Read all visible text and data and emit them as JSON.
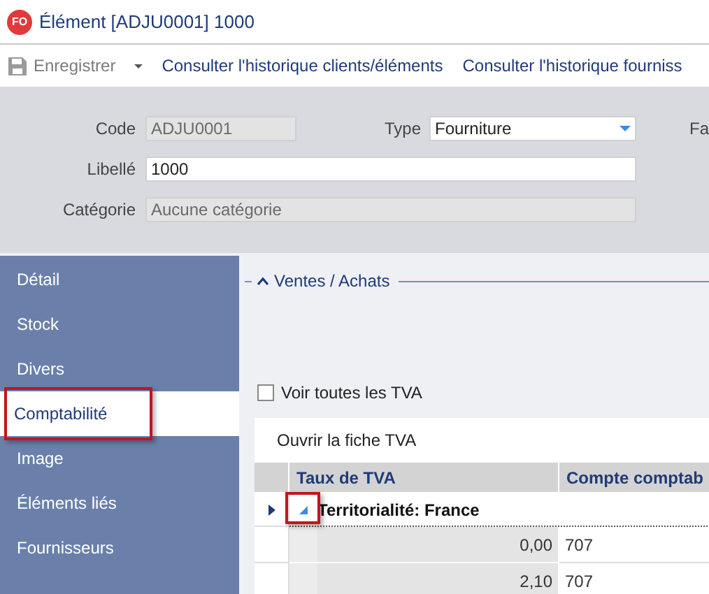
{
  "window": {
    "title": "Élément [ADJU0001] 1000",
    "logo": "FO"
  },
  "toolbar": [
    {
      "kind": "save",
      "label": "Enregistrer",
      "disabled": true
    },
    {
      "kind": "link",
      "label": "Consulter l'historique clients/éléments",
      "disabled": false
    },
    {
      "kind": "link",
      "label": "Consulter l'historique fourniss",
      "disabled": false
    }
  ],
  "form": {
    "code": {
      "label": "Code",
      "value": "ADJU0001",
      "disabled": true
    },
    "type": {
      "label": "Type",
      "value": "Fourniture"
    },
    "cut_label": "Fa",
    "libelle": {
      "label": "Libellé",
      "value": "1000"
    },
    "categorie": {
      "label": "Catégorie",
      "value": "Aucune catégorie",
      "disabled": true
    }
  },
  "sidebar": {
    "items": [
      {
        "label": "Détail",
        "selected": false,
        "highlighted": false
      },
      {
        "label": "Stock",
        "selected": false,
        "highlighted": false
      },
      {
        "label": "Divers",
        "selected": false,
        "highlighted": false
      },
      {
        "label": "Comptabilité",
        "selected": true,
        "highlighted": true
      },
      {
        "label": "Image",
        "selected": false,
        "highlighted": false
      },
      {
        "label": "Éléments liés",
        "selected": false,
        "highlighted": false
      },
      {
        "label": "Fournisseurs",
        "selected": false,
        "highlighted": false
      }
    ]
  },
  "section": {
    "title": "Ventes / Achats",
    "expanded": true
  },
  "show_all_vat": {
    "label": "Voir toutes les TVA",
    "checked": false
  },
  "open_button": "Ouvrir la fiche TVA",
  "grid": {
    "columns": [
      "Taux de TVA",
      "Compte comptab"
    ],
    "groups": [
      {
        "label": "Territorialité: France",
        "expanded": true,
        "current": true,
        "expander_highlighted": true,
        "rows": [
          [
            "0,00",
            "707"
          ],
          [
            "2,10",
            "707"
          ]
        ]
      }
    ]
  }
}
